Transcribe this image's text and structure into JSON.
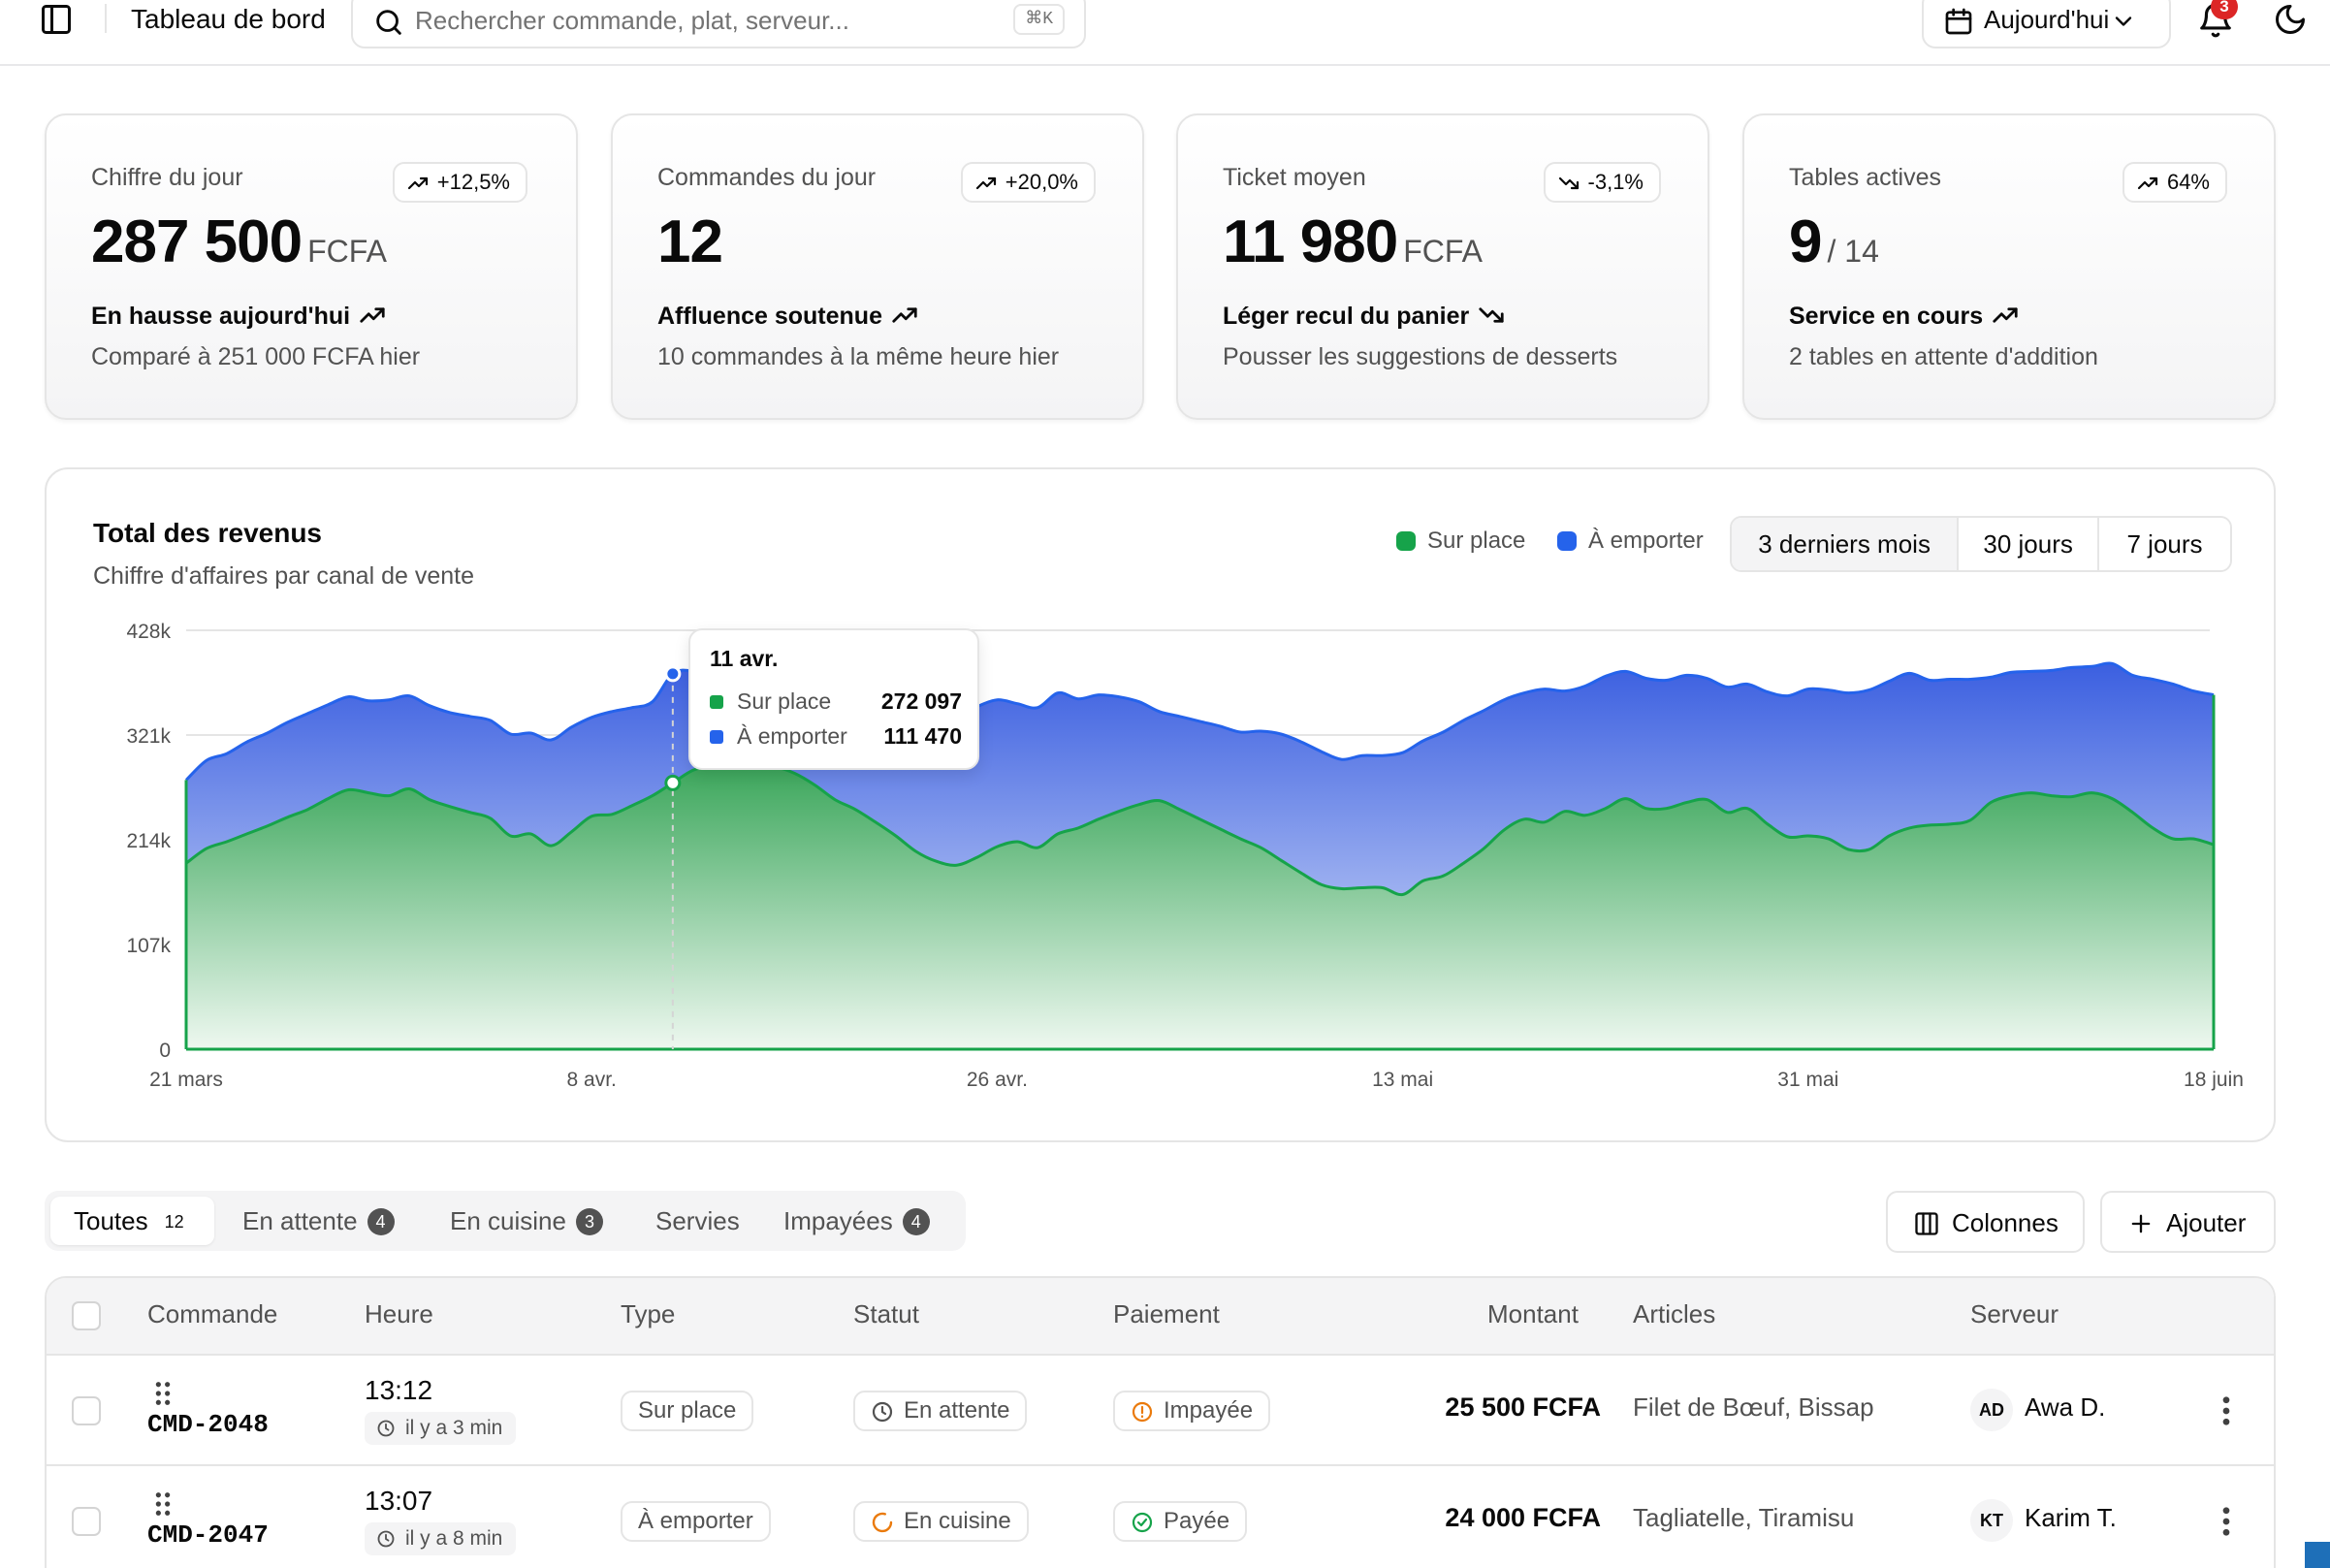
{
  "header": {
    "title": "Tableau de bord",
    "search_placeholder": "Rechercher commande, plat, serveur...",
    "search_shortcut": "⌘K",
    "date_filter": "Aujourd'hui",
    "notifications_count": "3"
  },
  "kpis": [
    {
      "label": "Chiffre du jour",
      "badge": "+12,5%",
      "badge_trend": "up",
      "value": "287 500",
      "unit": "FCFA",
      "trend_text": "En hausse aujourd'hui",
      "trend": "up",
      "sub": "Comparé à 251 000 FCFA hier"
    },
    {
      "label": "Commandes du jour",
      "badge": "+20,0%",
      "badge_trend": "up",
      "value": "12",
      "unit": "",
      "trend_text": "Affluence soutenue",
      "trend": "up",
      "sub": "10 commandes à la même heure hier"
    },
    {
      "label": "Ticket moyen",
      "badge": "-3,1%",
      "badge_trend": "down",
      "value": "11 980",
      "unit": "FCFA",
      "trend_text": "Léger recul du panier",
      "trend": "down",
      "sub": "Pousser les suggestions de desserts"
    },
    {
      "label": "Tables actives",
      "badge": "64%",
      "badge_trend": "up",
      "value": "9",
      "unit": "/ 14",
      "trend_text": "Service en cours",
      "trend": "up",
      "sub": "2 tables en attente d'addition"
    }
  ],
  "revenue": {
    "title": "Total des revenus",
    "subtitle": "Chiffre d'affaires par canal de vente",
    "legend": [
      {
        "name": "Sur place",
        "color": "#16a34a"
      },
      {
        "name": "À emporter",
        "color": "#2563eb"
      }
    ],
    "ranges": [
      "3 derniers mois",
      "30 jours",
      "7 jours"
    ],
    "active_range": "3 derniers mois",
    "tooltip": {
      "date": "11 avr.",
      "sur_place_label": "Sur place",
      "sur_place_value": "272 097",
      "emporter_label": "À emporter",
      "emporter_value": "111 470"
    }
  },
  "chart_data": {
    "type": "area",
    "stacked": true,
    "x_start": "21 mars",
    "x_end": "18 juin",
    "x_ticks": [
      "21 mars",
      "8 avr.",
      "26 avr.",
      "13 mai",
      "31 mai",
      "18 juin"
    ],
    "y_ticks": [
      "0",
      "107k",
      "214k",
      "321k",
      "428k"
    ],
    "ylim": [
      0,
      428000
    ],
    "grid": true,
    "series": [
      {
        "name": "Sur place",
        "color": "#16a34a",
        "values": [
          190000,
          205000,
          212000,
          220000,
          228000,
          237000,
          245000,
          256000,
          265000,
          262000,
          259000,
          266000,
          255000,
          248000,
          242000,
          236000,
          218000,
          220000,
          208000,
          222000,
          238000,
          240000,
          249000,
          259000,
          272097,
          285000,
          290000,
          291000,
          292000,
          289000,
          282000,
          270000,
          255000,
          245000,
          232000,
          218000,
          202000,
          192000,
          188000,
          196000,
          207000,
          212000,
          206000,
          220000,
          226000,
          235000,
          243000,
          250000,
          254000,
          245000,
          235000,
          225000,
          215000,
          206000,
          193000,
          180000,
          168000,
          164000,
          165000,
          165000,
          158000,
          172000,
          177000,
          190000,
          205000,
          224000,
          235000,
          232000,
          243000,
          239000,
          246000,
          256000,
          246000,
          246000,
          252000,
          255000,
          242000,
          246000,
          230000,
          217000,
          218000,
          215000,
          204000,
          204000,
          218000,
          226000,
          229000,
          230000,
          234000,
          252000,
          259000,
          262000,
          259000,
          258000,
          262000,
          256000,
          242000,
          226000,
          215000,
          215000,
          209000
        ]
      },
      {
        "name": "À emporter",
        "color": "#2563eb",
        "values": [
          85000,
          90000,
          90000,
          94000,
          95000,
          97000,
          98000,
          96000,
          95000,
          94000,
          98000,
          95000,
          96000,
          96000,
          98000,
          100000,
          104000,
          103000,
          108000,
          107000,
          101000,
          105000,
          100000,
          96000,
          111470,
          101000,
          86000,
          84000,
          82000,
          81000,
          79000,
          78000,
          83000,
          88000,
          98000,
          116000,
          139000,
          146000,
          153000,
          154000,
          150000,
          141000,
          143000,
          144000,
          132000,
          127000,
          117000,
          105000,
          91000,
          95000,
          100000,
          105000,
          109000,
          119000,
          129000,
          134000,
          136000,
          132000,
          135000,
          135000,
          145000,
          143000,
          147000,
          146000,
          141000,
          133000,
          129000,
          136000,
          123000,
          132000,
          135000,
          130000,
          133000,
          131000,
          130000,
          124000,
          128000,
          127000,
          135000,
          144000,
          150000,
          152000,
          160000,
          163000,
          158000,
          158000,
          148000,
          148000,
          144000,
          128000,
          126000,
          124000,
          128000,
          132000,
          129000,
          138000,
          140000,
          152000,
          158000,
          151000,
          153000
        ]
      }
    ]
  },
  "orders": {
    "tabs": [
      {
        "label": "Toutes",
        "count": "12"
      },
      {
        "label": "En attente",
        "count": "4"
      },
      {
        "label": "En cuisine",
        "count": "3"
      },
      {
        "label": "Servies",
        "count": ""
      },
      {
        "label": "Impayées",
        "count": "4"
      }
    ],
    "columns_btn": "Colonnes",
    "add_btn": "Ajouter",
    "headers": [
      "Commande",
      "Heure",
      "Type",
      "Statut",
      "Paiement",
      "Montant",
      "Articles",
      "Serveur"
    ],
    "rows": [
      {
        "id": "CMD-2048",
        "time": "13:12",
        "ago": "il y a 3 min",
        "type": "Sur place",
        "status": "En attente",
        "payment": "Impayée",
        "amount": "25 500 FCFA",
        "articles": "Filet de Bœuf, Bissap",
        "initials": "AD",
        "server": "Awa D."
      },
      {
        "id": "CMD-2047",
        "time": "13:07",
        "ago": "il y a 8 min",
        "type": "À emporter",
        "status": "En cuisine",
        "payment": "Payée",
        "amount": "24 000 FCFA",
        "articles": "Tagliatelle, Tiramisu",
        "initials": "KT",
        "server": "Karim T."
      }
    ]
  }
}
